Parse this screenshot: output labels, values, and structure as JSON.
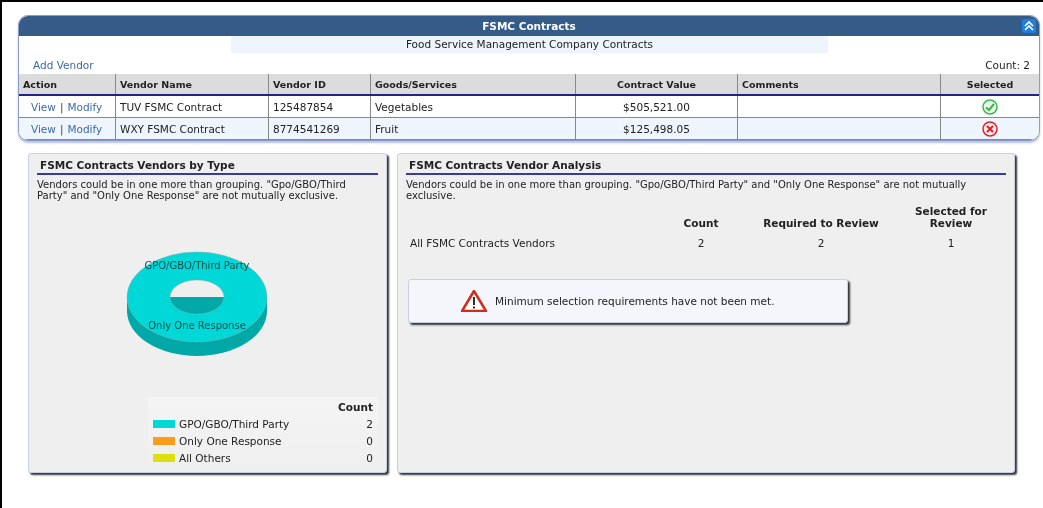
{
  "panel": {
    "title": "FSMC Contracts",
    "subtitle": "Food Service Management Company Contracts",
    "add_link": "Add Vendor",
    "count": "Count: 2"
  },
  "table": {
    "columns": [
      "Action",
      "Vendor Name",
      "Vendor ID",
      "Goods/Services",
      "Contract Value",
      "Comments",
      "Selected"
    ],
    "rows": [
      {
        "actions": [
          "View",
          "|",
          "Modify"
        ],
        "vendor_name": "TUV FSMC Contract",
        "vendor_id": "125487854",
        "goods": "Vegetables",
        "contract_value": "$505,521.00",
        "selected": true
      },
      {
        "actions": [
          "View",
          "|",
          "Modify"
        ],
        "vendor_name": "WXY FSMC Contract",
        "vendor_id": "8774541269",
        "goods": "Fruit",
        "contract_value": "$125,498.05",
        "selected": false
      }
    ]
  },
  "by_type": {
    "title": "FSMC Contracts Vendors by Type",
    "note": "Vendors could be in one more than grouping. \"Gpo/GBO/Third Party\" and \"Only One Response\" are not mutually exclusive.",
    "slice_labels": [
      "GPO/GBO/Third Party",
      "Only One Response"
    ],
    "legend_heading": "Count",
    "legend": [
      {
        "label": "GPO/GBO/Third Party",
        "count": "2",
        "color": "#00d8d8"
      },
      {
        "label": "Only One Response",
        "count": "0",
        "color": "#ff9c1c"
      },
      {
        "label": "All Others",
        "count": "0",
        "color": "#dede10"
      }
    ]
  },
  "analysis": {
    "title": "FSMC Contracts Vendor Analysis",
    "note": "Vendors could be in one more than grouping. \"Gpo/GBO/Third Party\" and \"Only One Response\" are not mutually exclusive.",
    "columns": [
      "Count",
      "Required to Review",
      "Selected for Review"
    ],
    "rows": [
      {
        "label": "All FSMC Contracts Vendors",
        "values": [
          "2",
          "2",
          "1"
        ]
      }
    ],
    "warning": "Minimum selection requirements have not been met."
  }
}
